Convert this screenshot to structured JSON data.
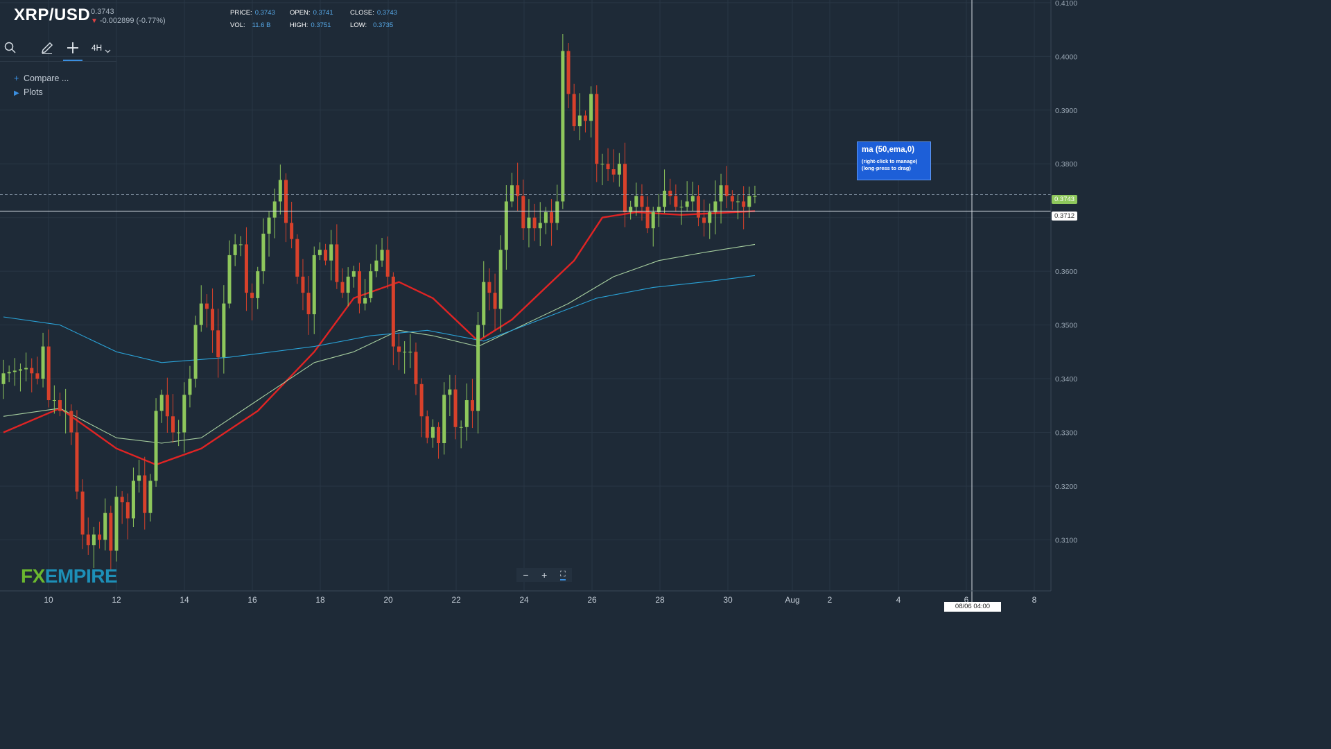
{
  "header": {
    "symbol": "XRP/USD",
    "price": "0.3743",
    "change": "-0.002899 (-0.77%)",
    "stats": {
      "price_label": "PRICE:",
      "price": "0.3743",
      "open_label": "OPEN:",
      "open": "0.3741",
      "close_label": "CLOSE:",
      "close": "0.3743",
      "vol_label": "VOL:",
      "vol": "11.6 B",
      "high_label": "HIGH:",
      "high": "0.3751",
      "low_label": "LOW:",
      "low": "0.3735"
    }
  },
  "toolbar": {
    "timeframe": "4H",
    "icons": [
      "search-icon",
      "pencil-icon",
      "crosshair-icon",
      "chevron-down-icon"
    ]
  },
  "side_menu": {
    "compare": "Compare ...",
    "plots": "Plots"
  },
  "tooltip": {
    "title": "ma (50,ema,0)",
    "line1": "(right-click to manage)",
    "line2": "(long-press to drag)"
  },
  "price_tags": {
    "last": "0.3743",
    "cursor": "0.3712"
  },
  "time_tag": "08/06 04:00",
  "logo": {
    "fx": "FX",
    "empire": "EMPIRE"
  },
  "colors": {
    "background": "#1e2a37",
    "up": "#8ec75c",
    "down": "#d8412b",
    "ema50": "#e02424",
    "ma_green": "#a8d0a0",
    "ma_blue": "#2aa3d8"
  },
  "chart_data": {
    "type": "candlestick",
    "title": "XRP/USD",
    "timeframe": "4H",
    "ylim": [
      0.3005,
      0.4105
    ],
    "y_ticks": [
      "0.3100",
      "0.3200",
      "0.3300",
      "0.3400",
      "0.3500",
      "0.3600",
      "0.3700",
      "0.3800",
      "0.3900",
      "0.4000",
      "0.4100"
    ],
    "x_ticks": [
      "10",
      "12",
      "14",
      "16",
      "18",
      "20",
      "22",
      "24",
      "26",
      "28",
      "30",
      "Aug",
      "2",
      "4",
      "6",
      "8"
    ],
    "last_price": 0.3743,
    "crosshair": {
      "price": 0.3712,
      "time": "08/06 04:00"
    },
    "close_path": [
      [
        0,
        0.341
      ],
      [
        4,
        0.342
      ],
      [
        6,
        0.34
      ],
      [
        7,
        0.346
      ],
      [
        8,
        0.336
      ],
      [
        9,
        0.336
      ],
      [
        10,
        0.334
      ],
      [
        11,
        0.334
      ],
      [
        12,
        0.33
      ],
      [
        13,
        0.319
      ],
      [
        14,
        0.311
      ],
      [
        15,
        0.309
      ],
      [
        16,
        0.311
      ],
      [
        17,
        0.31
      ],
      [
        18,
        0.315
      ],
      [
        19,
        0.308
      ],
      [
        20,
        0.318
      ],
      [
        21,
        0.317
      ],
      [
        22,
        0.314
      ],
      [
        23,
        0.321
      ],
      [
        24,
        0.322
      ],
      [
        25,
        0.315
      ],
      [
        26,
        0.321
      ],
      [
        27,
        0.334
      ],
      [
        28,
        0.337
      ],
      [
        29,
        0.333
      ],
      [
        30,
        0.33
      ],
      [
        31,
        0.33
      ],
      [
        32,
        0.337
      ],
      [
        33,
        0.34
      ],
      [
        34,
        0.35
      ],
      [
        35,
        0.354
      ],
      [
        36,
        0.353
      ],
      [
        37,
        0.349
      ],
      [
        38,
        0.344
      ],
      [
        39,
        0.354
      ],
      [
        40,
        0.363
      ],
      [
        41,
        0.365
      ],
      [
        42,
        0.365
      ],
      [
        43,
        0.356
      ],
      [
        44,
        0.355
      ],
      [
        45,
        0.36
      ],
      [
        46,
        0.367
      ],
      [
        47,
        0.37
      ],
      [
        48,
        0.373
      ],
      [
        49,
        0.377
      ],
      [
        50,
        0.369
      ],
      [
        51,
        0.366
      ],
      [
        52,
        0.359
      ],
      [
        53,
        0.356
      ],
      [
        54,
        0.352
      ],
      [
        55,
        0.363
      ],
      [
        56,
        0.364
      ],
      [
        57,
        0.362
      ],
      [
        58,
        0.365
      ],
      [
        59,
        0.358
      ],
      [
        60,
        0.356
      ],
      [
        61,
        0.359
      ],
      [
        62,
        0.36
      ],
      [
        63,
        0.354
      ],
      [
        64,
        0.355
      ],
      [
        65,
        0.36
      ],
      [
        66,
        0.362
      ],
      [
        67,
        0.364
      ],
      [
        68,
        0.359
      ],
      [
        69,
        0.346
      ],
      [
        70,
        0.345
      ],
      [
        71,
        0.345
      ],
      [
        72,
        0.345
      ],
      [
        73,
        0.339
      ],
      [
        74,
        0.333
      ],
      [
        75,
        0.329
      ],
      [
        76,
        0.331
      ],
      [
        77,
        0.328
      ],
      [
        78,
        0.337
      ],
      [
        79,
        0.338
      ],
      [
        80,
        0.331
      ],
      [
        81,
        0.331
      ],
      [
        82,
        0.336
      ],
      [
        83,
        0.334
      ],
      [
        84,
        0.35
      ],
      [
        85,
        0.358
      ],
      [
        86,
        0.356
      ],
      [
        87,
        0.353
      ],
      [
        88,
        0.364
      ],
      [
        89,
        0.373
      ],
      [
        90,
        0.376
      ],
      [
        91,
        0.374
      ],
      [
        92,
        0.368
      ],
      [
        93,
        0.37
      ],
      [
        94,
        0.368
      ],
      [
        95,
        0.369
      ],
      [
        96,
        0.371
      ],
      [
        97,
        0.369
      ],
      [
        98,
        0.373
      ],
      [
        99,
        0.401
      ],
      [
        100,
        0.393
      ],
      [
        101,
        0.387
      ],
      [
        102,
        0.389
      ],
      [
        103,
        0.388
      ],
      [
        104,
        0.393
      ],
      [
        105,
        0.38
      ],
      [
        106,
        0.38
      ],
      [
        107,
        0.379
      ],
      [
        108,
        0.378
      ],
      [
        109,
        0.38
      ],
      [
        110,
        0.371
      ],
      [
        111,
        0.372
      ],
      [
        112,
        0.374
      ],
      [
        113,
        0.372
      ],
      [
        114,
        0.368
      ],
      [
        115,
        0.371
      ],
      [
        116,
        0.372
      ],
      [
        117,
        0.375
      ],
      [
        118,
        0.374
      ],
      [
        119,
        0.372
      ],
      [
        120,
        0.372
      ],
      [
        121,
        0.373
      ],
      [
        122,
        0.374
      ],
      [
        123,
        0.37
      ],
      [
        124,
        0.369
      ],
      [
        125,
        0.371
      ],
      [
        126,
        0.373
      ],
      [
        127,
        0.376
      ],
      [
        128,
        0.374
      ],
      [
        129,
        0.373
      ],
      [
        130,
        0.373
      ],
      [
        131,
        0.372
      ],
      [
        132,
        0.374
      ],
      [
        133,
        0.374
      ]
    ],
    "series": [
      {
        "name": "ma (50,ema,0)",
        "color": "#e02424",
        "points": [
          [
            0,
            0.33
          ],
          [
            10,
            0.3345
          ],
          [
            20,
            0.327
          ],
          [
            27,
            0.324
          ],
          [
            35,
            0.327
          ],
          [
            45,
            0.334
          ],
          [
            55,
            0.345
          ],
          [
            62,
            0.355
          ],
          [
            70,
            0.358
          ],
          [
            76,
            0.355
          ],
          [
            84,
            0.347
          ],
          [
            90,
            0.351
          ],
          [
            96,
            0.357
          ],
          [
            101,
            0.362
          ],
          [
            106,
            0.37
          ],
          [
            112,
            0.371
          ],
          [
            120,
            0.3705
          ],
          [
            133,
            0.3712
          ]
        ]
      },
      {
        "color": "#a8d0a0",
        "points": [
          [
            0,
            0.333
          ],
          [
            10,
            0.3345
          ],
          [
            20,
            0.329
          ],
          [
            28,
            0.328
          ],
          [
            35,
            0.329
          ],
          [
            45,
            0.336
          ],
          [
            55,
            0.343
          ],
          [
            62,
            0.345
          ],
          [
            70,
            0.349
          ],
          [
            76,
            0.348
          ],
          [
            84,
            0.346
          ],
          [
            92,
            0.35
          ],
          [
            100,
            0.354
          ],
          [
            108,
            0.359
          ],
          [
            116,
            0.362
          ],
          [
            124,
            0.3635
          ],
          [
            133,
            0.365
          ]
        ]
      },
      {
        "color": "#2aa3d8",
        "points": [
          [
            0,
            0.3515
          ],
          [
            10,
            0.35
          ],
          [
            20,
            0.345
          ],
          [
            28,
            0.343
          ],
          [
            40,
            0.344
          ],
          [
            55,
            0.346
          ],
          [
            65,
            0.348
          ],
          [
            75,
            0.349
          ],
          [
            85,
            0.347
          ],
          [
            95,
            0.351
          ],
          [
            105,
            0.355
          ],
          [
            115,
            0.357
          ],
          [
            124,
            0.358
          ],
          [
            133,
            0.3592
          ]
        ]
      }
    ]
  }
}
